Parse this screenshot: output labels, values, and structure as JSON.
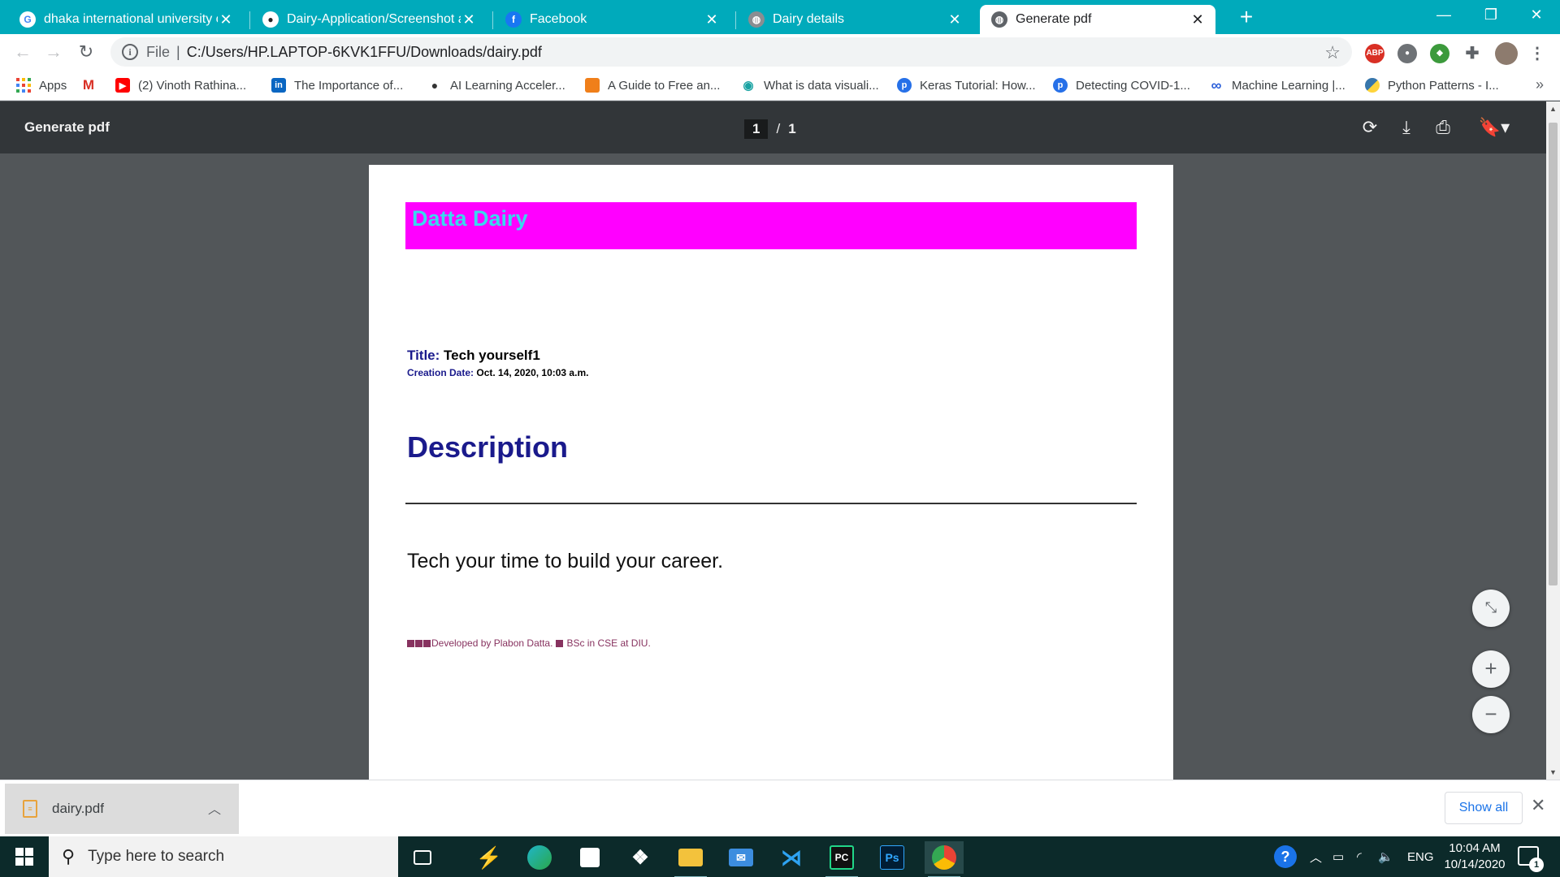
{
  "tabs": [
    {
      "title": "dhaka international university co",
      "icon": "google-icon",
      "active": false
    },
    {
      "title": "Dairy-Application/Screenshot at",
      "icon": "github-icon",
      "active": false
    },
    {
      "title": "Facebook",
      "icon": "facebook-icon",
      "active": false
    },
    {
      "title": "Dairy details",
      "icon": "globe-icon",
      "active": false
    },
    {
      "title": "Generate pdf",
      "icon": "globe-icon",
      "active": true
    }
  ],
  "address": {
    "scheme": "File",
    "url": "C:/Users/HP.LAPTOP-6KVK1FFU/Downloads/dairy.pdf"
  },
  "bookmarks": [
    {
      "label": "Apps",
      "icon": "apps-grid-icon"
    },
    {
      "label": "",
      "icon": "gmail-icon"
    },
    {
      "label": "(2) Vinoth Rathina...",
      "icon": "youtube-icon"
    },
    {
      "label": "The Importance of...",
      "icon": "linkedin-icon"
    },
    {
      "label": "AI Learning Acceler...",
      "icon": "dot-icon"
    },
    {
      "label": "A Guide to Free an...",
      "icon": "chat-icon"
    },
    {
      "label": "What is data visuali...",
      "icon": "eye-icon"
    },
    {
      "label": "Keras Tutorial: How...",
      "icon": "p-icon"
    },
    {
      "label": "Detecting COVID-1...",
      "icon": "p-icon"
    },
    {
      "label": "Machine Learning |...",
      "icon": "infinity-icon"
    },
    {
      "label": "Python Patterns - I...",
      "icon": "python-icon"
    }
  ],
  "extensions": {
    "abp": "ABP"
  },
  "pdf": {
    "title": "Generate pdf",
    "page_current": "1",
    "page_separator": "/",
    "page_total": "1"
  },
  "document": {
    "banner": "Datta Dairy",
    "title_label": "Title:",
    "title_value": "Tech yourself1",
    "date_label": "Creation Date:",
    "date_value": "Oct. 14, 2020, 10:03 a.m.",
    "heading": "Description",
    "body": "Tech your time to build your career.",
    "footer_part1": "Developed by Plabon Datta.",
    "footer_part2": "BSc in CSE at DIU."
  },
  "download_shelf": {
    "file_name": "dairy.pdf",
    "show_all": "Show all"
  },
  "taskbar": {
    "search_placeholder": "Type here to search",
    "language": "ENG",
    "time": "10:04 AM",
    "date": "10/14/2020",
    "notification_count": "1"
  },
  "colors": {
    "tabstrip": "#00aabb",
    "banner": "#ff00ff",
    "banner_text": "#3ad7ee",
    "heading": "#1a1a8c",
    "footer": "#87325f"
  }
}
